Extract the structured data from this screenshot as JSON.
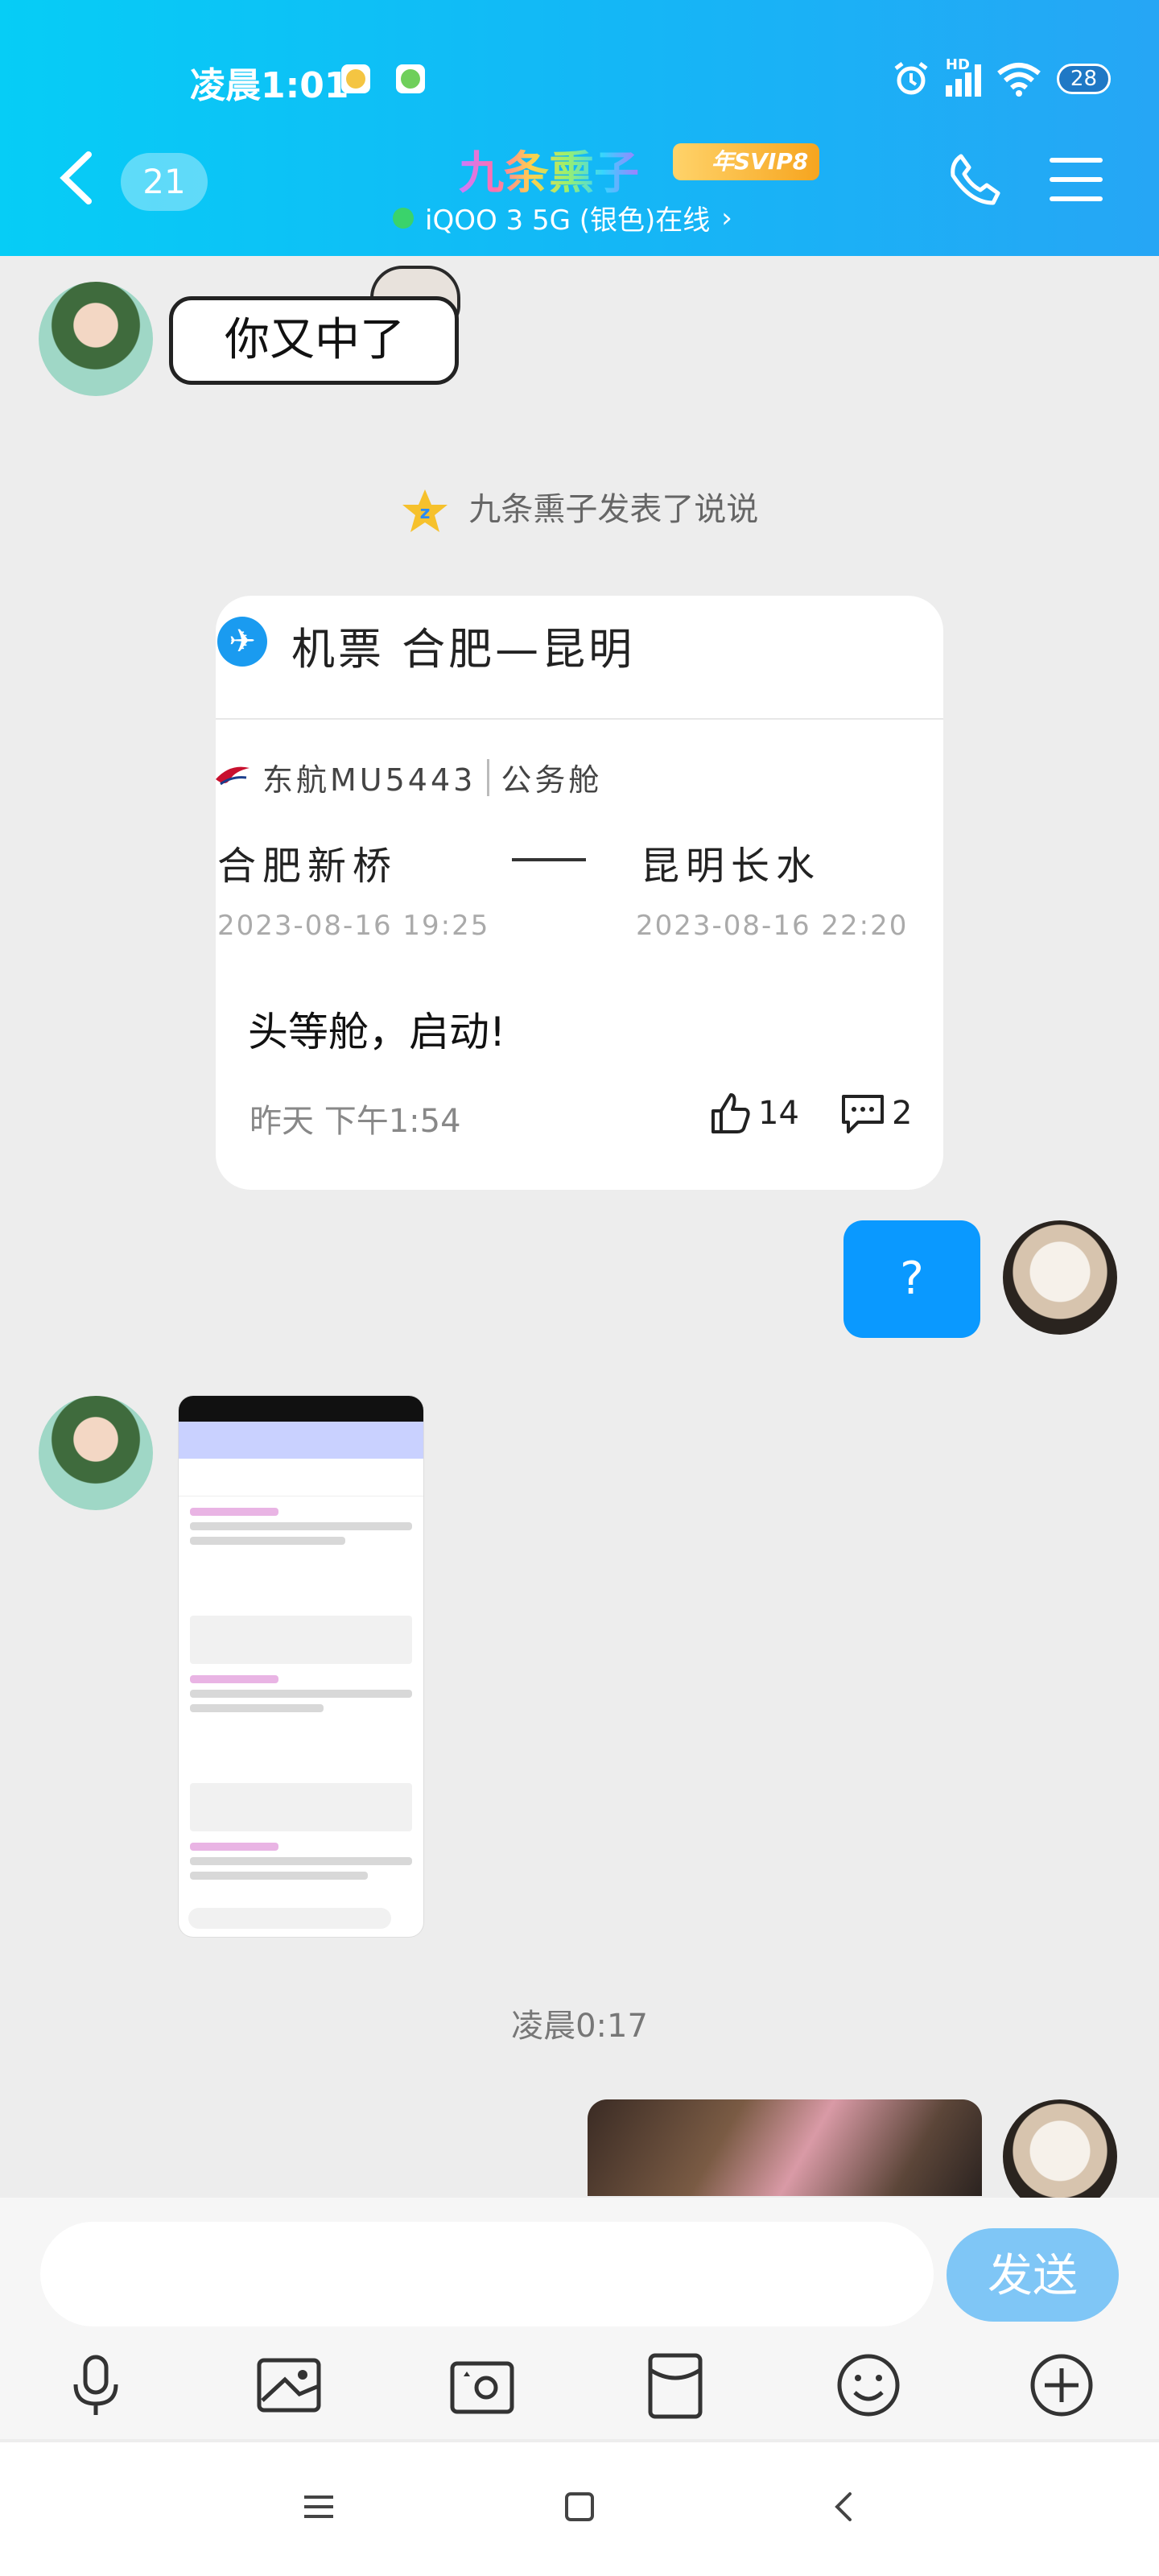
{
  "status_bar": {
    "time": "凌晨1:01",
    "signal_label": "HD",
    "battery": "28"
  },
  "header": {
    "back_count": "21",
    "title": "九条熏子",
    "vip_badge": "年SVIP8",
    "device_status": "iQOO 3 5G (银色)在线",
    "online_color": "#3ad36b"
  },
  "messages": {
    "sticker_text": "你又中了",
    "system_note": "九条熏子发表了说说",
    "card": {
      "title": "机票  合肥—昆明",
      "airline": "东航MU5443",
      "cabin": "公务舱",
      "from_city": "合肥新桥",
      "to_city": "昆明长水",
      "depart_time": "2023-08-16 19:25",
      "arrive_time": "2023-08-16 22:20",
      "post_text": "头等舱，启动!",
      "post_time": "昨天 下午1:54",
      "likes": "14",
      "comments": "2"
    },
    "reply": "?",
    "timestamp": "凌晨0:17"
  },
  "input": {
    "placeholder": "",
    "send_label": "发送"
  },
  "colors": {
    "accent": "#0a99ff",
    "header_from": "#06cdf6",
    "header_to": "#26a6f5"
  }
}
